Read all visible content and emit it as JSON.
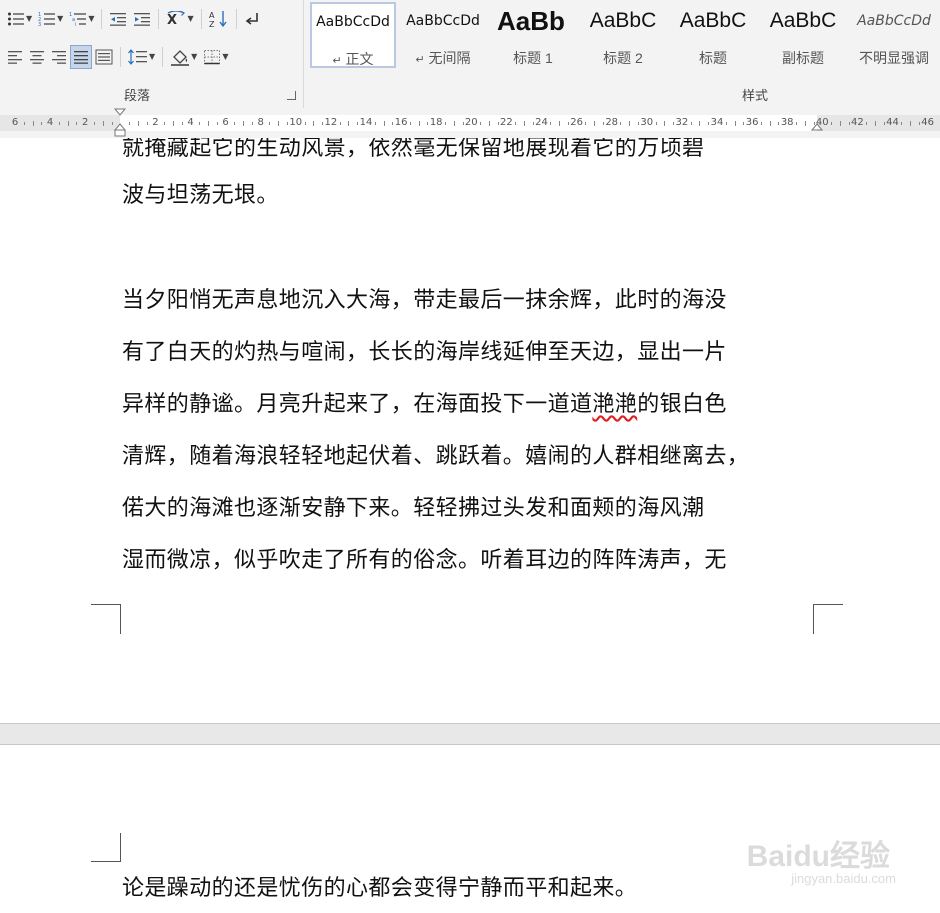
{
  "ribbon": {
    "paragraph_group": {
      "label": "段落",
      "row1_tools": [
        {
          "name": "bullets-icon",
          "has_caret": true
        },
        {
          "name": "numbering-icon",
          "has_caret": true
        },
        {
          "name": "multilevel-list-icon",
          "has_caret": true
        },
        {
          "name": "decrease-indent-icon",
          "has_caret": false
        },
        {
          "name": "increase-indent-icon",
          "has_caret": false
        },
        {
          "name": "chinese-layout-icon",
          "has_caret": true
        },
        {
          "name": "sort-icon",
          "has_caret": false
        },
        {
          "name": "show-formatting-marks-icon",
          "has_caret": false
        }
      ],
      "row2_tools": [
        {
          "name": "align-left-icon",
          "has_caret": false
        },
        {
          "name": "align-center-icon",
          "has_caret": false
        },
        {
          "name": "align-right-icon",
          "has_caret": false
        },
        {
          "name": "justify-icon",
          "has_caret": false,
          "active": true
        },
        {
          "name": "distributed-icon",
          "has_caret": false
        },
        {
          "name": "line-spacing-icon",
          "has_caret": true
        },
        {
          "name": "shading-icon",
          "has_caret": true
        },
        {
          "name": "borders-icon",
          "has_caret": true
        }
      ],
      "sort_glyph": "A↓Z"
    },
    "styles_group": {
      "label": "样式",
      "styles": [
        {
          "sample": "AaBbCcDd",
          "name": "正文",
          "marker": "↵",
          "selected": true
        },
        {
          "sample": "AaBbCcDd",
          "name": "无间隔",
          "marker": "↵",
          "selected": false
        },
        {
          "sample": "AaBb",
          "name": "标题 1",
          "marker": "",
          "selected": false
        },
        {
          "sample": "AaBbC",
          "name": "标题 2",
          "marker": "",
          "selected": false
        },
        {
          "sample": "AaBbC",
          "name": "标题",
          "marker": "",
          "selected": false
        },
        {
          "sample": "AaBbC",
          "name": "副标题",
          "marker": "",
          "selected": false
        },
        {
          "sample": "AaBbCcDd",
          "name": "不明显强调",
          "marker": "",
          "selected": false
        }
      ]
    }
  },
  "ruler": {
    "labels": [
      "6",
      "4",
      "2",
      "",
      "2",
      "4",
      "6",
      "8",
      "10",
      "12",
      "14",
      "16",
      "18",
      "20",
      "22",
      "24",
      "26",
      "28",
      "30",
      "32",
      "34",
      "36",
      "38",
      "40",
      "42",
      "44",
      "46"
    ]
  },
  "document": {
    "page1_lines": [
      "就掩藏起它的生动风景，依然毫无保留地展现着它的万顷碧",
      "波与坦荡无垠。",
      "当夕阳悄无声息地沉入大海，带走最后一抹余辉，此时的海没",
      "有了白天的灼热与喧闹，长长的海岸线延伸至天边，显出一片",
      "异样的静谧。月亮升起来了，在海面投下一道道",
      "滟滟",
      "的银白色",
      "清辉，随着海浪轻轻地起伏着、跳跃着。嬉闹的人群相继离去，",
      "偌大的海滩也逐渐安静下来。轻轻拂过头发和面颊的海风潮",
      "湿而微凉，似乎吹走了所有的俗念。听着耳边的阵阵涛声，无"
    ],
    "page2_lines": [
      "论是躁动的还是忧伤的心都会变得宁静而平和起来。"
    ]
  },
  "watermark": {
    "text": "Baidu经验",
    "url": "jingyan.baidu.com"
  },
  "colors": {
    "ribbon_bg": "#f3f3f3",
    "active_button": "#c5d5ea",
    "selected_style_border": "#b9c9e4",
    "spellcheck_underline": "#e02020",
    "page_gap": "#e8e8e8"
  }
}
